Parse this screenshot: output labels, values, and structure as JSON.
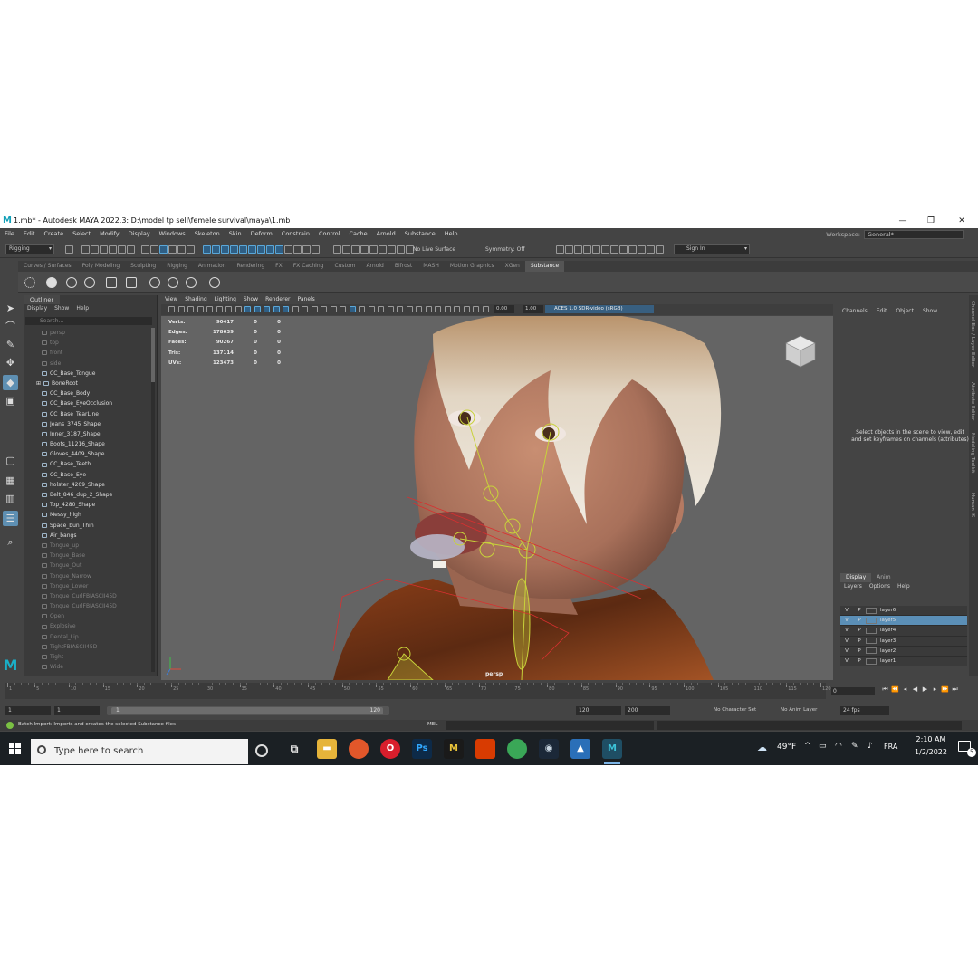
{
  "window": {
    "title": "1.mb* - Autodesk MAYA 2022.3: D:\\model tp sell\\femele survival\\maya\\1.mb",
    "app_icon": "M",
    "minimize": "—",
    "maximize": "❐",
    "close": "✕"
  },
  "menubar": {
    "items": [
      "File",
      "Edit",
      "Create",
      "Select",
      "Modify",
      "Display",
      "Windows",
      "Skeleton",
      "Skin",
      "Deform",
      "Constrain",
      "Control",
      "Cache",
      "Arnold",
      "Substance",
      "Help"
    ],
    "workspace_label": "Workspace:",
    "workspace_value": "General*"
  },
  "statusline": {
    "menuset": "Rigging",
    "live_surface": "No Live Surface",
    "symmetry": "Symmetry: Off",
    "sign_in": "Sign In"
  },
  "shelf": {
    "tabs": [
      "Curves / Surfaces",
      "Poly Modeling",
      "Sculpting",
      "Rigging",
      "Animation",
      "Rendering",
      "FX",
      "FX Caching",
      "Custom",
      "Arnold",
      "Bifrost",
      "MASH",
      "Motion Graphics",
      "XGen",
      "Substance"
    ],
    "active_tab": "Substance"
  },
  "outliner": {
    "tab": "Outliner",
    "menus": [
      "Display",
      "Show",
      "Help"
    ],
    "search_placeholder": "Search...",
    "items": [
      {
        "name": "persp",
        "dim": true
      },
      {
        "name": "top",
        "dim": true
      },
      {
        "name": "front",
        "dim": true
      },
      {
        "name": "side",
        "dim": true
      },
      {
        "name": "CC_Base_Tongue",
        "dim": false
      },
      {
        "name": "BoneRoot",
        "dim": false
      },
      {
        "name": "CC_Base_Body",
        "dim": false
      },
      {
        "name": "CC_Base_EyeOcclusion",
        "dim": false
      },
      {
        "name": "CC_Base_TearLine",
        "dim": false
      },
      {
        "name": "Jeans_3745_Shape",
        "dim": false
      },
      {
        "name": "Inner_3187_Shape",
        "dim": false
      },
      {
        "name": "Boots_11216_Shape",
        "dim": false
      },
      {
        "name": "Gloves_4409_Shape",
        "dim": false
      },
      {
        "name": "CC_Base_Teeth",
        "dim": false
      },
      {
        "name": "CC_Base_Eye",
        "dim": false
      },
      {
        "name": "holster_4209_Shape",
        "dim": false
      },
      {
        "name": "Belt_846_dup_2_Shape",
        "dim": false
      },
      {
        "name": "Top_4280_Shape",
        "dim": false
      },
      {
        "name": "Messy_high",
        "dim": false
      },
      {
        "name": "Space_bun_Thin",
        "dim": false
      },
      {
        "name": "Air_bangs",
        "dim": false
      },
      {
        "name": "Tongue_up",
        "dim": true
      },
      {
        "name": "Tongue_Base",
        "dim": true
      },
      {
        "name": "Tongue_Out",
        "dim": true
      },
      {
        "name": "Tongue_Narrow",
        "dim": true
      },
      {
        "name": "Tongue_Lower",
        "dim": true
      },
      {
        "name": "Tongue_CurlFBIASCII45D",
        "dim": true
      },
      {
        "name": "Tongue_CurlFBIASCII45D",
        "dim": true
      },
      {
        "name": "Open",
        "dim": true
      },
      {
        "name": "Explosive",
        "dim": true
      },
      {
        "name": "Dental_Lip",
        "dim": true
      },
      {
        "name": "TightFBIASCII45D",
        "dim": true
      },
      {
        "name": "Tight",
        "dim": true
      },
      {
        "name": "Wide",
        "dim": true
      }
    ]
  },
  "viewport": {
    "menus": [
      "View",
      "Shading",
      "Lighting",
      "Show",
      "Renderer",
      "Panels"
    ],
    "exposure": "0.00",
    "gamma": "1.00",
    "color_space": "ACES 1.0 SDR-video (sRGB)",
    "hud": [
      {
        "label": "Verts:",
        "value": "90417",
        "a": "0",
        "b": "0"
      },
      {
        "label": "Edges:",
        "value": "178639",
        "a": "0",
        "b": "0"
      },
      {
        "label": "Faces:",
        "value": "90267",
        "a": "0",
        "b": "0"
      },
      {
        "label": "Tris:",
        "value": "137114",
        "a": "0",
        "b": "0"
      },
      {
        "label": "UVs:",
        "value": "123473",
        "a": "0",
        "b": "0"
      }
    ],
    "camera": "persp"
  },
  "channelbox": {
    "menus": [
      "Channels",
      "Edit",
      "Object",
      "Show"
    ],
    "message": "Select objects in the scene to view, edit and set keyframes on channels (attributes)",
    "side_tabs": [
      "Channel Box / Layer Editor",
      "Attribute Editor",
      "Modeling Toolkit",
      "Human IK"
    ]
  },
  "layer_editor": {
    "tabs": [
      "Display",
      "Anim"
    ],
    "menus": [
      "Layers",
      "Options",
      "Help"
    ],
    "layers": [
      {
        "name": "layer6",
        "v": "V",
        "p": "P",
        "selected": false
      },
      {
        "name": "layer5",
        "v": "V",
        "p": "P",
        "selected": true
      },
      {
        "name": "layer4",
        "v": "V",
        "p": "P",
        "selected": false
      },
      {
        "name": "layer3",
        "v": "V",
        "p": "P",
        "selected": false
      },
      {
        "name": "layer2",
        "v": "V",
        "p": "P",
        "selected": false
      },
      {
        "name": "layer1",
        "v": "V",
        "p": "P",
        "selected": false
      }
    ]
  },
  "timeline": {
    "ticks": [
      "1",
      "5",
      "10",
      "15",
      "20",
      "25",
      "30",
      "35",
      "40",
      "45",
      "50",
      "55",
      "60",
      "65",
      "70",
      "75",
      "80",
      "85",
      "90",
      "95",
      "100",
      "105",
      "110",
      "115",
      "120"
    ],
    "current_frame": "0"
  },
  "range": {
    "start": "1",
    "start2": "1",
    "bar_start": "1",
    "bar_end": "120",
    "end": "120",
    "anim_end": "200",
    "character_set": "No Character Set",
    "anim_layer": "No Anim Layer",
    "fps": "24 fps"
  },
  "helpline": {
    "text": "Batch Import: Imports and creates the selected Substance files",
    "mel": "MEL"
  },
  "taskbar": {
    "search_placeholder": "Type here to search",
    "weather": "49°F",
    "language": "FRA",
    "time": "2:10 AM",
    "date": "1/2/2022",
    "notifications": "5"
  },
  "colors": {
    "maya_bg": "#444444",
    "viewport_bg": "#646464",
    "selection_blue": "#5b8fb7",
    "taskbar": "#1b2024"
  }
}
